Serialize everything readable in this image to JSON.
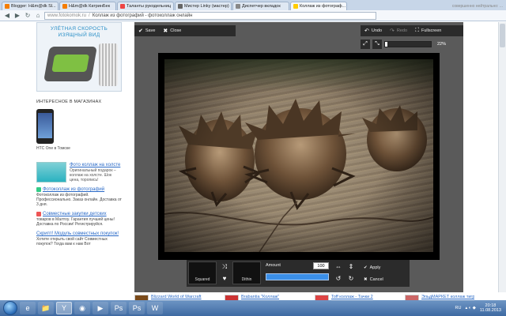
{
  "browser": {
    "tabs": [
      {
        "label": "Blogger: H&m@dk Sl...",
        "color": "#f57d00"
      },
      {
        "label": "H&m@dk КатринБек",
        "color": "#f57d00"
      },
      {
        "label": "Таланты рукодельниц",
        "color": "#e44"
      },
      {
        "label": "Мистер Linky (мастер)",
        "color": "#666"
      },
      {
        "label": "Диспетчер вкладок",
        "color": "#888"
      },
      {
        "label": "Коллаж из фотограф...",
        "color": "#fc0"
      }
    ],
    "active_tab": 5,
    "right_hint": "совершенно нейтрально: ...",
    "url_host": "www.fotokomok.ru",
    "url_title": "Коллаж из фотографий - фотоколлаж онлайн"
  },
  "sidebar": {
    "ad_title": "УЛЁТНАЯ СКОРОСТЬ\nИЗЯЩНЫЙ ВИД",
    "section_heading": "ИНТЕРЕСНОЕ В МАГАЗИНАХ",
    "phone_caption": "HTC One в Томске",
    "promo": {
      "link": "Фото коллаж на холсте",
      "text": "Оригинальный подарок – коллаж на холсте. Шок цена, торопись!"
    },
    "block2": {
      "link": "Фотоколлаж из фотографий",
      "text": "Фотоколлаж из фотографий. Профессионально. Заказ онлайн. Доставка от 3 дня."
    },
    "block3": {
      "link": "Совместные закупки детских",
      "text": "товаров в Maлтоy. Гарантия лучшей цены! Доставка по России! Регистрируйся."
    },
    "block4": {
      "link": "Скрипт! Модуль совместных покупок!",
      "text": "Хотите открыть свой сайт Совместных покупок? Тогда вам к нам Вот"
    }
  },
  "editor": {
    "save": "Save",
    "close": "Close",
    "undo": "Undo",
    "redo": "Redo",
    "fullscreen": "Fullscreen",
    "zoom_label": "22%",
    "zoom_fraction": 0.05,
    "swatch1": "Squared",
    "swatch2": "Dithin",
    "amount_label": "Amount",
    "amount_value": "100",
    "amount_fraction": 1.0,
    "apply": "Apply",
    "cancel": "Cancel"
  },
  "ads": [
    {
      "label": "Blizzard World of Warcraft",
      "color": "#7a4a1a"
    },
    {
      "label": "Brabantia \"Коллаж\"",
      "color": "#c33"
    },
    {
      "label": "Toff коллаж - Тачки 2",
      "color": "#d44"
    },
    {
      "label": "ЭльдМАРКЕТ коллаж тигр",
      "color": "#c66"
    }
  ],
  "taskbar": {
    "lang": "RU",
    "time": "20:18",
    "date": "11.08.2013",
    "apps": [
      "e",
      "📁",
      "Y",
      "◉",
      "▶",
      "Ps",
      "Ps",
      "W"
    ]
  },
  "colors": {
    "toolbar": "#2b2b2b",
    "editor_bg": "#5a5a5a",
    "accent_blue": "#3b8fe8",
    "link": "#2a6ac7"
  }
}
